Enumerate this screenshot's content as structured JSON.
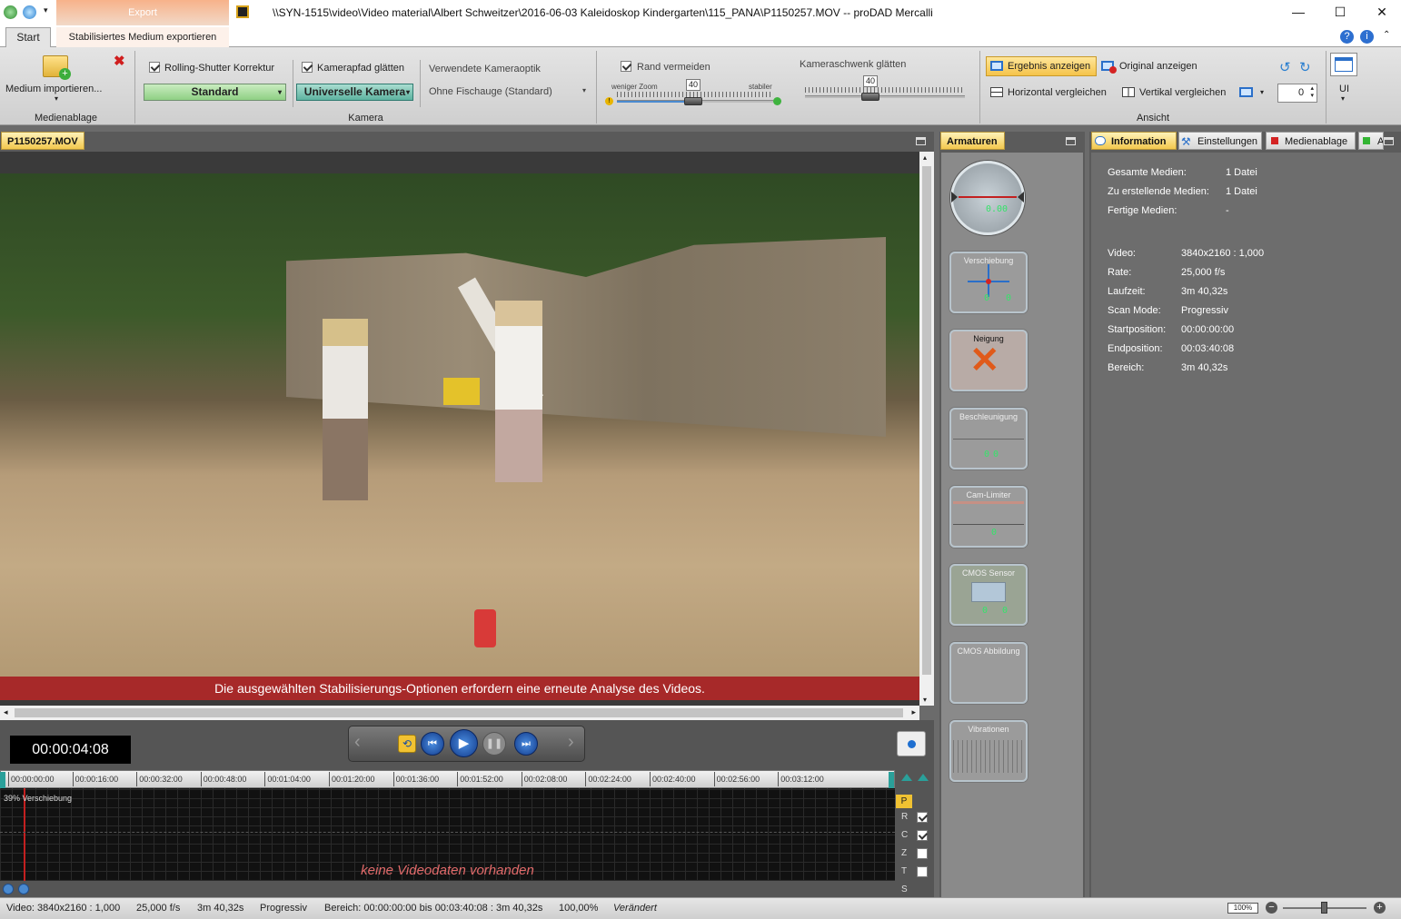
{
  "window": {
    "title": "\\\\SYN-1515\\video\\Video material\\Albert Schweitzer\\2016-06-03 Kaleidoskop Kindergarten\\115_PANA\\P1150257.MOV -- proDAD Mercalli",
    "context_tab": "Export",
    "tabs": [
      "Start",
      "Stabilisiertes Medium exportieren"
    ]
  },
  "ribbon": {
    "medienablage": {
      "import_label": "Medium importieren...",
      "group_label": "Medienablage"
    },
    "kamera": {
      "rolling_shutter_label": "Rolling-Shutter Korrektur",
      "rolling_shutter_checked": true,
      "rolling_shutter_value": "Standard",
      "kamerapfad_label": "Kamerapfad glätten",
      "kamerapfad_checked": true,
      "kamerapfad_value": "Universelle Kamera",
      "optik_label": "Verwendete Kameraoptik",
      "optik_value": "Ohne Fischauge (Standard)",
      "group_label": "Kamera"
    },
    "rand": {
      "label": "Rand vermeiden",
      "checked": true,
      "left_label": "weniger Zoom",
      "right_label": "stabiler",
      "value": "40",
      "level": 0.4
    },
    "schwenk": {
      "label": "Kameraschwenk glätten",
      "value": "40",
      "level": 0.4
    },
    "ansicht": {
      "ergebnis_label": "Ergebnis anzeigen",
      "original_label": "Original anzeigen",
      "horizontal_label": "Horizontal vergleichen",
      "vertikal_label": "Vertikal vergleichen",
      "rotation_value": "0",
      "ui_label": "UI",
      "group_label": "Ansicht"
    }
  },
  "video_pane": {
    "tab_label": "P1150257.MOV",
    "warning": "Die ausgewählten Stabilisierungs-Optionen erfordern eine erneute Analyse des Videos."
  },
  "transport": {
    "timecode": "00:00:04:08"
  },
  "timeline": {
    "ticks": [
      "00:00:00:00",
      "00:00:16:00",
      "00:00:32:00",
      "00:00:48:00",
      "00:01:04:00",
      "00:01:20:00",
      "00:01:36:00",
      "00:01:52:00",
      "00:02:08:00",
      "00:02:24:00",
      "00:02:40:00",
      "00:02:56:00",
      "00:03:12:00"
    ],
    "track_label": "39% Verschiebung",
    "empty_message": "keine Videodaten vorhanden",
    "side_letters": [
      "P",
      "R",
      "C",
      "Z",
      "T",
      "S"
    ],
    "side_checks": [
      true,
      true,
      false,
      false
    ]
  },
  "armaturen": {
    "tab_label": "Armaturen",
    "gauges": [
      "Verschiebung",
      "Neigung",
      "Beschleunigung",
      "Cam-Limiter",
      "CMOS Sensor",
      "CMOS Abbildung",
      "Vibrationen"
    ],
    "compass_value": "0.00",
    "zero": "0"
  },
  "info_pane": {
    "tabs": [
      "Information",
      "Einstellungen",
      "Medienablage",
      "A"
    ],
    "rows": [
      {
        "k": "Gesamte Medien:",
        "v": "1 Datei"
      },
      {
        "k": "Zu erstellende Medien:",
        "v": "1 Datei"
      },
      {
        "k": "Fertige Medien:",
        "v": "-"
      }
    ],
    "rows2": [
      {
        "k": "Video:",
        "v": "3840x2160 : 1,000"
      },
      {
        "k": "Rate:",
        "v": "25,000 f/s"
      },
      {
        "k": "Laufzeit:",
        "v": "3m 40,32s"
      },
      {
        "k": "Scan Mode:",
        "v": "Progressiv"
      },
      {
        "k": "Startposition:",
        "v": "00:00:00:00"
      },
      {
        "k": "Endposition:",
        "v": "00:03:40:08"
      },
      {
        "k": "Bereich:",
        "v": "3m 40,32s"
      }
    ]
  },
  "status": {
    "video": "Video: 3840x2160 : 1,000",
    "rate": "25,000 f/s",
    "laufzeit": "3m 40,32s",
    "scan": "Progressiv",
    "bereich": "Bereich: 00:00:00:00 bis 00:03:40:08 : 3m 40,32s",
    "prozent": "100,00%",
    "state": "Verändert",
    "zoom": "100%"
  },
  "colors": {
    "accent_orange": "#f3c84e",
    "warning_red": "#b83030",
    "info_bg": "#6d6d6d",
    "timeline_bg": "#111111"
  }
}
